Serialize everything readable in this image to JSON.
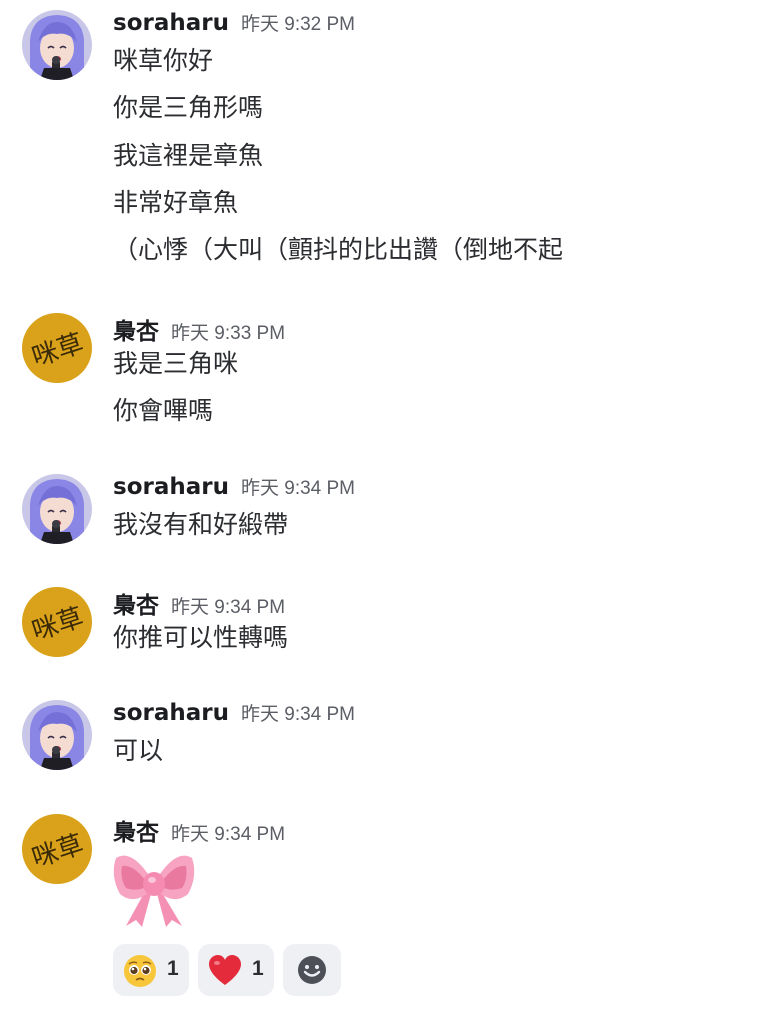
{
  "colors": {
    "background": "#ffffff",
    "author": "#1c1d20",
    "timestamp": "#5c5e66",
    "text": "#2b2d31",
    "reaction_bg": "#eef0f3",
    "avatar_izumi_bg": "#d9a21a",
    "avatar_soraharu_hair": "#8a86e6"
  },
  "messages": [
    {
      "author": "soraharu",
      "timestamp": "昨天 9:32 PM",
      "avatar_icon": "anime-character-avatar-icon",
      "lines": [
        "咪草你好",
        "你是三角形嗎",
        "我這裡是章魚",
        "非常好章魚",
        "（心悸（大叫（顫抖的比出讚（倒地不起"
      ]
    },
    {
      "author": "梟杏",
      "timestamp": "昨天 9:33 PM",
      "avatar_icon": "text-avatar-icon",
      "lines": [
        "我是三角咪",
        "你會嗶嗎"
      ]
    },
    {
      "author": "soraharu",
      "timestamp": "昨天 9:34 PM",
      "avatar_icon": "anime-character-avatar-icon",
      "lines": [
        "我沒有和好緞帶"
      ]
    },
    {
      "author": "梟杏",
      "timestamp": "昨天 9:34 PM",
      "avatar_icon": "text-avatar-icon",
      "lines": [
        "你推可以性轉嗎"
      ]
    },
    {
      "author": "soraharu",
      "timestamp": "昨天 9:34 PM",
      "avatar_icon": "anime-character-avatar-icon",
      "lines": [
        "可以"
      ]
    },
    {
      "author": "梟杏",
      "timestamp": "昨天 9:34 PM",
      "avatar_icon": "text-avatar-icon",
      "lines": [],
      "attachment_icon": "pink-ribbon-bow-icon"
    }
  ],
  "avatar_text": "咪草",
  "reactions": [
    {
      "emoji": "pleading-face-icon",
      "count": "1"
    },
    {
      "emoji": "red-heart-icon",
      "count": "1"
    }
  ],
  "add_reaction_icon": "add-reaction-smiley-icon"
}
